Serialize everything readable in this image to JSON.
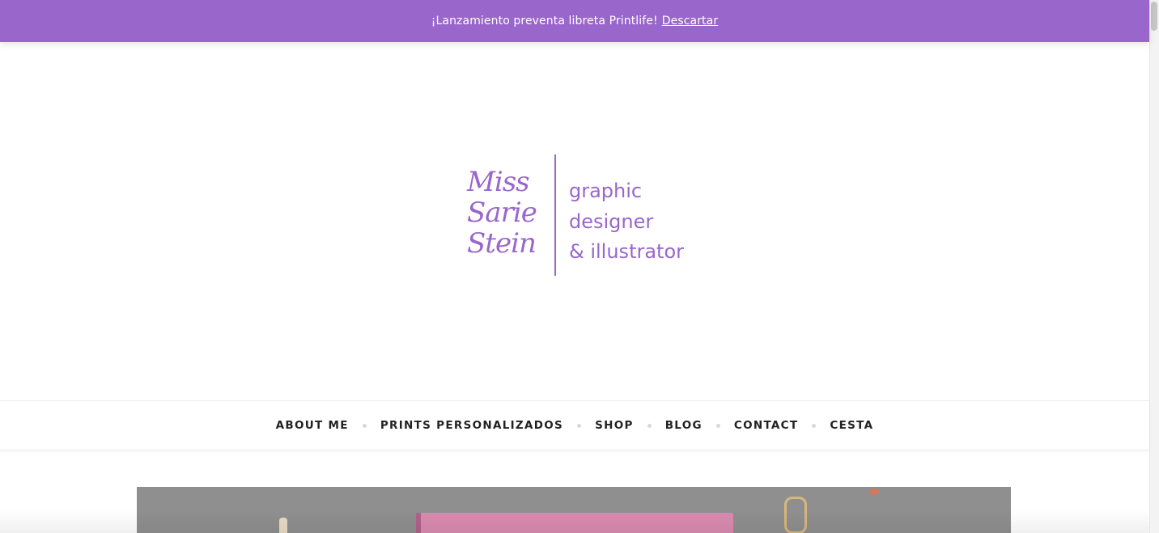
{
  "notice": {
    "message": "¡Lanzamiento preventa libreta Printlife!",
    "dismiss_label": "Descartar"
  },
  "logo": {
    "script_lines": [
      "Miss",
      "Sarie",
      "Stein"
    ],
    "tagline_lines": [
      "graphic",
      "designer",
      "& illustrator"
    ]
  },
  "nav": {
    "items": [
      {
        "label": "ABOUT ME"
      },
      {
        "label": "PRINTS PERSONALIZADOS"
      },
      {
        "label": "SHOP"
      },
      {
        "label": "BLOG"
      },
      {
        "label": "CONTACT"
      },
      {
        "label": "CESTA"
      }
    ]
  },
  "colors": {
    "brand_purple": "#9966cc",
    "nav_text": "#222222",
    "background": "#ffffff"
  }
}
